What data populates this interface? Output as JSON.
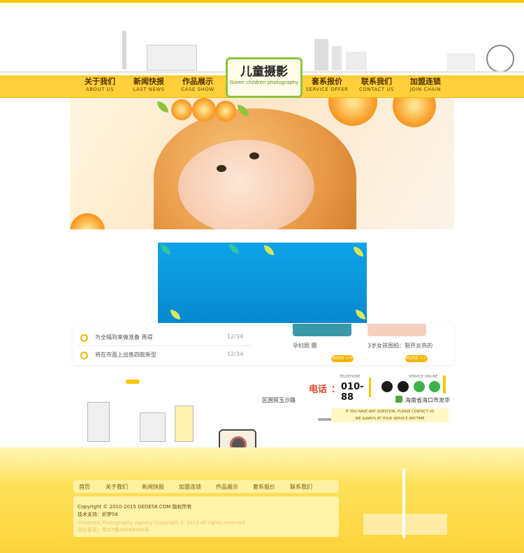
{
  "logo": {
    "title": "儿童摄影",
    "subtitle": "Green children photography"
  },
  "nav": {
    "left": [
      {
        "cn": "关于我们",
        "en": "ABOUT US"
      },
      {
        "cn": "新闻快报",
        "en": "LAST NEWS"
      },
      {
        "cn": "作品展示",
        "en": "CASE SHOW"
      }
    ],
    "right": [
      {
        "cn": "套系报价",
        "en": "SERVICE OFFER"
      },
      {
        "cn": "联系我们",
        "en": "CONTACT US"
      },
      {
        "cn": "加盟连锁",
        "en": "JOIN CHAIN"
      }
    ]
  },
  "news": [
    {
      "text": "为全幅到来做准备 再得",
      "date": "12/34"
    },
    {
      "text": "将在市面上出售四款新型",
      "date": "12/34"
    }
  ],
  "gallery": [
    {
      "caption": "孕妇照 摄",
      "more": "MORE >>"
    },
    {
      "caption": "3岁女孩图拍：裂开炎热的",
      "more": "MORE >>"
    }
  ],
  "contact": {
    "tel_label_en": "TELEPHONE",
    "tel_label_cn": "电话",
    "tel_colon": "：",
    "tel_number": "010-88",
    "service_label": "SERVICE ONLINE",
    "address": "海南省海口市龙华",
    "road": "区国贸玉沙路",
    "message_line1": "IF YOU HAVE ANY QUESTION, PLEASE CONTACT US",
    "message_line2": "WE ALWAYS AT YOUR SERVICE ANYTIME"
  },
  "footer_nav": [
    "首页",
    "关于我们",
    "新闻快报",
    "加盟连锁",
    "作品展示",
    "套系报价",
    "联系我们"
  ],
  "footer": {
    "copyright": "Copyright © 2010-2015 DEDE58.COM 版权所有",
    "support": "技术支持：织梦58",
    "english": "Childrens Photography Agency Copyright © 2013 All rights reserved",
    "icp": "网站备案：粤ICP备49489485号"
  },
  "colors": {
    "accent": "#f7c600",
    "nav_bg": "#ffd03a",
    "panel_blue": "#0fa3e8",
    "tel_red": "#e0452a"
  }
}
